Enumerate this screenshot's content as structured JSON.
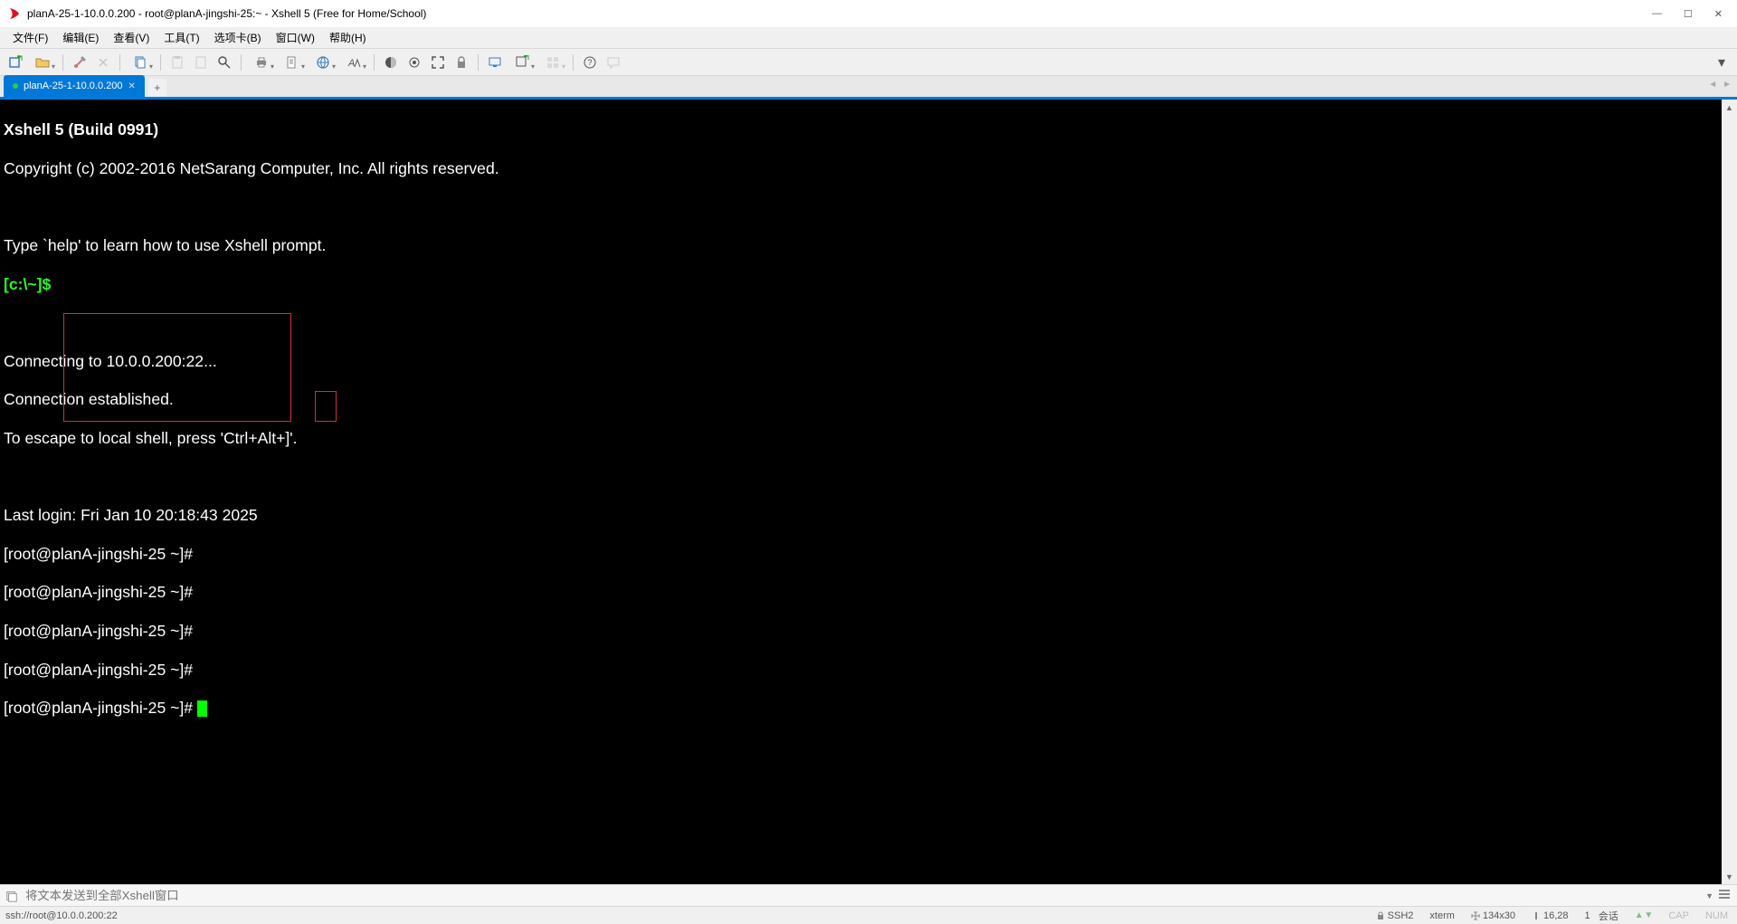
{
  "window": {
    "title": "planA-25-1-10.0.0.200 - root@planA-jingshi-25:~ - Xshell 5 (Free for Home/School)"
  },
  "menu": {
    "file": "文件(F)",
    "edit": "编辑(E)",
    "view": "查看(V)",
    "tools": "工具(T)",
    "tabs": "选项卡(B)",
    "window": "窗口(W)",
    "help": "帮助(H)"
  },
  "tab": {
    "label": "planA-25-1-10.0.0.200"
  },
  "terminal": {
    "banner_line1": "Xshell 5 (Build 0991)",
    "banner_line2": "Copyright (c) 2002-2016 NetSarang Computer, Inc. All rights reserved.",
    "banner_line3": "Type `help' to learn how to use Xshell prompt.",
    "local_prompt": "[c:\\~]$",
    "conn_line1": "Connecting to 10.0.0.200:22...",
    "conn_line2": "Connection established.",
    "conn_line3": "To escape to local shell, press 'Ctrl+Alt+]'.",
    "last_login": "Last login: Fri Jan 10 20:18:43 2025",
    "prompt": "[root@planA-jingshi-25 ~]# "
  },
  "compose": {
    "placeholder": "将文本发送到全部Xshell窗口"
  },
  "status": {
    "uri": "ssh://root@10.0.0.200:22",
    "proto": "SSH2",
    "term": "xterm",
    "size": "134x30",
    "cursor": "16,28",
    "sessions_num": "1",
    "sessions_label": "会话",
    "cap": "CAP",
    "num": "NUM"
  }
}
